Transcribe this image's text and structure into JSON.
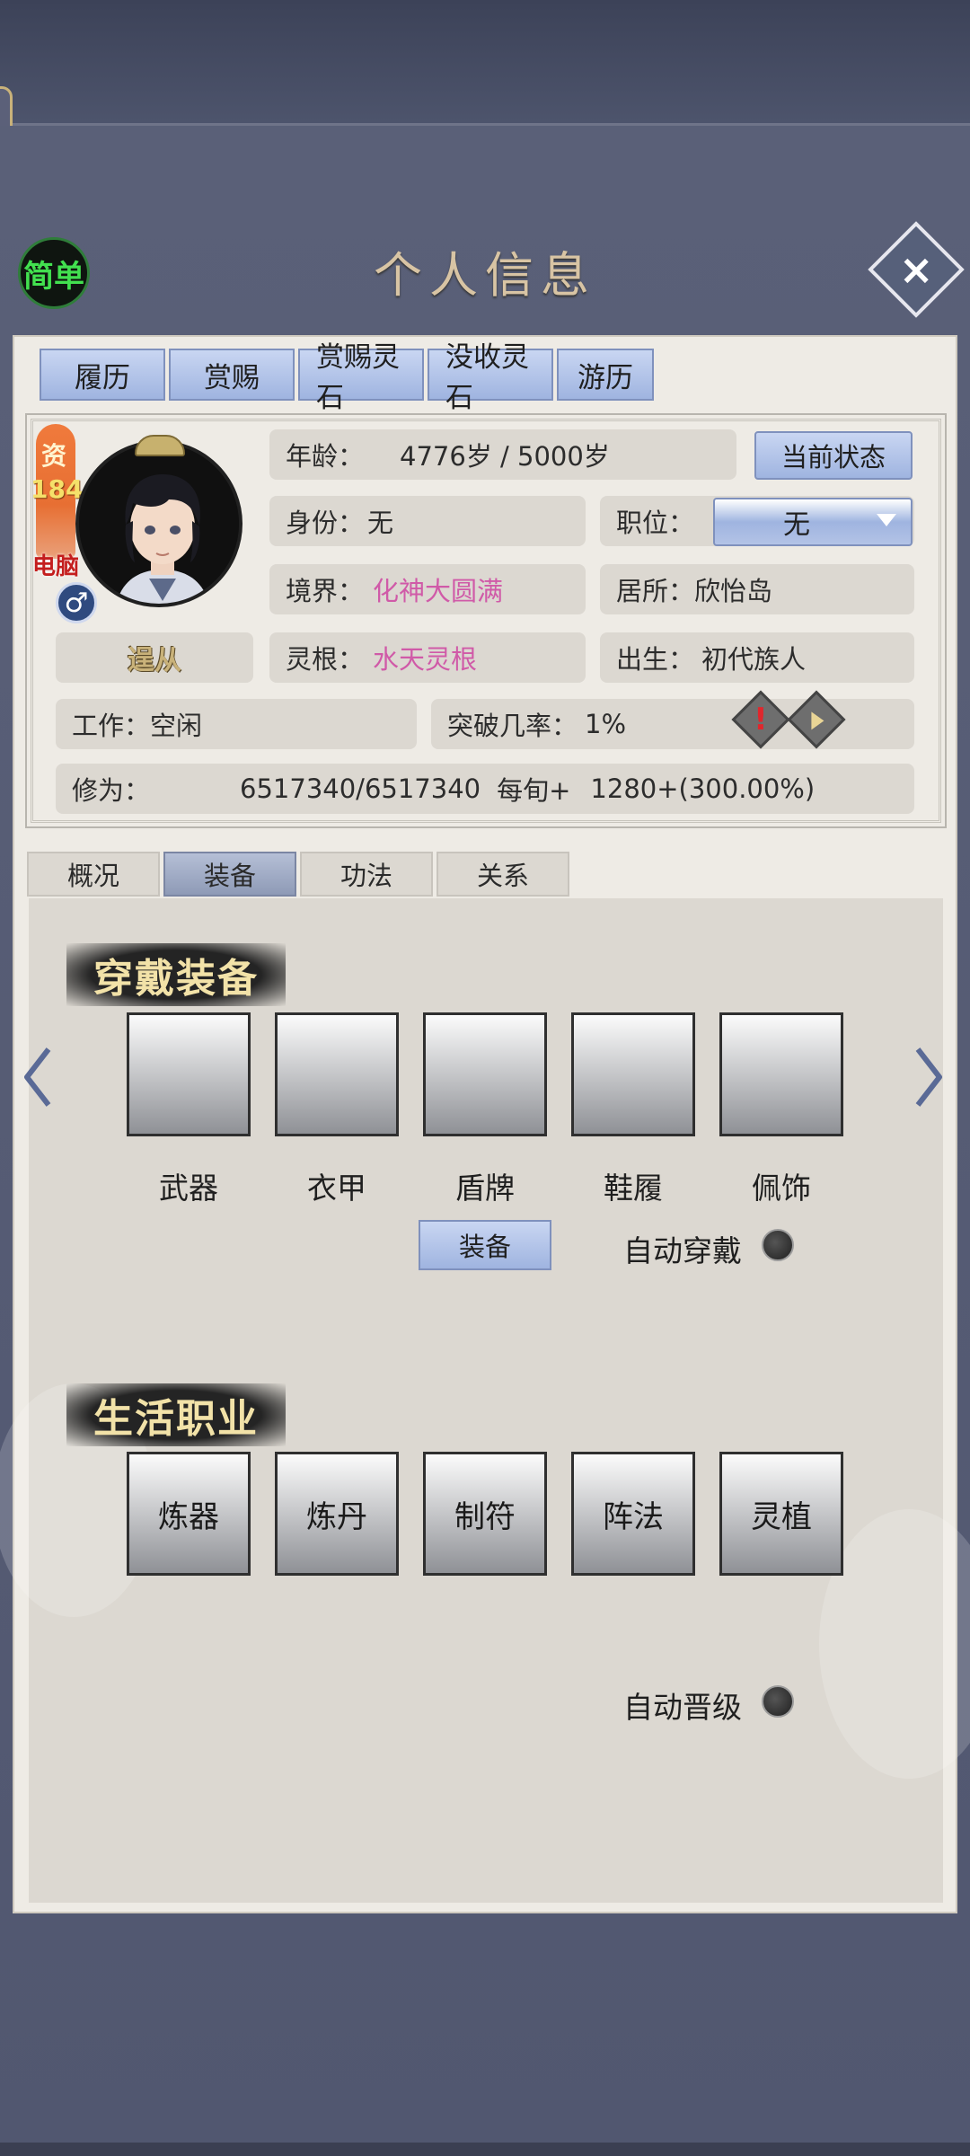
{
  "header": {
    "title": "个人信息",
    "mode_button": "简单",
    "close_icon": "close-icon"
  },
  "top_tabs": [
    "履历",
    "赏赐",
    "赏赐灵石",
    "没收灵石",
    "游历"
  ],
  "character": {
    "aptitude_char": "资",
    "aptitude_value": "184",
    "controller_tag": "电脑",
    "gender_symbol": "♂",
    "follower_label": "逞从",
    "age_label": "年龄：",
    "age_value": "4776岁 / 5000岁",
    "state_button": "当前状态",
    "identity_label": "身份：",
    "identity_value": "无",
    "position_label": "职位：",
    "position_value": "无",
    "realm_label": "境界：",
    "realm_value": "化神大圆满",
    "residence_label": "居所：",
    "residence_value": "欣怡岛",
    "root_label": "灵根：",
    "root_value": "水天灵根",
    "birth_label": "出生：",
    "birth_value": "初代族人",
    "work_label": "工作：",
    "work_value": "空闲",
    "breakthrough_label": "突破几率：",
    "breakthrough_value": "1%",
    "cultivation_label": "修为：",
    "cultivation_value": "6517340/6517340",
    "per_turn_label": "每旬+",
    "per_turn_value": "1280+(300.00%)"
  },
  "mid_tabs": [
    {
      "label": "概况",
      "active": false
    },
    {
      "label": "装备",
      "active": true
    },
    {
      "label": "功法",
      "active": false
    },
    {
      "label": "关系",
      "active": false
    }
  ],
  "equipment": {
    "title": "穿戴装备",
    "slots": [
      "武器",
      "衣甲",
      "盾牌",
      "鞋履",
      "佩饰"
    ],
    "equip_button": "装备",
    "auto_wear_label": "自动穿戴"
  },
  "life_jobs": {
    "title": "生活职业",
    "jobs": [
      "炼器",
      "炼丹",
      "制符",
      "阵法",
      "灵植"
    ],
    "auto_upgrade_label": "自动晋级"
  },
  "colors": {
    "accent_blue": "#9fb4e0",
    "pink_value": "#d05aa8",
    "title_gold": "#d8c4a4"
  }
}
